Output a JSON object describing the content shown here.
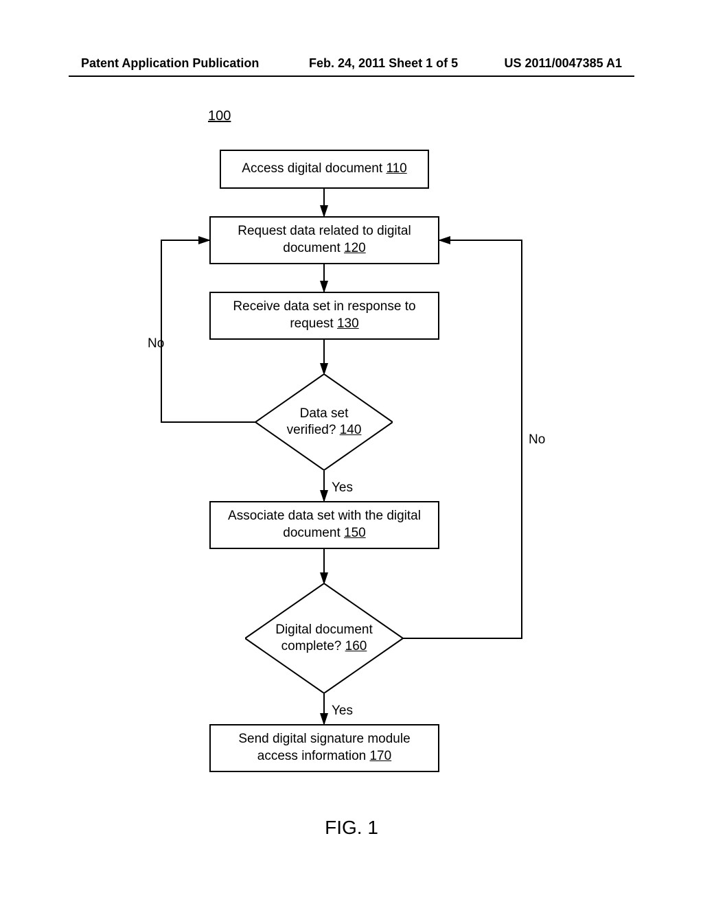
{
  "header": {
    "left": "Patent Application Publication",
    "mid": "Feb. 24, 2011  Sheet 1 of 5",
    "right": "US 2011/0047385 A1"
  },
  "diagram": {
    "ref": "100",
    "figure_caption": "FIG. 1",
    "nodes": {
      "n110": {
        "text": "Access digital document",
        "ref": "110"
      },
      "n120": {
        "text_line1": "Request data related to digital",
        "text_line2": "document",
        "ref": "120"
      },
      "n130": {
        "text_line1": "Receive data set in response to",
        "text_line2": "request",
        "ref": "130"
      },
      "n140": {
        "text_line1": "Data set",
        "text_line2": "verified?",
        "ref": "140"
      },
      "n150": {
        "text_line1": "Associate data set with the digital",
        "text_line2": "document",
        "ref": "150"
      },
      "n160": {
        "text_line1": "Digital document",
        "text_line2": "complete?",
        "ref": "160"
      },
      "n170": {
        "text_line1": "Send digital signature module",
        "text_line2": "access information",
        "ref": "170"
      }
    },
    "labels": {
      "no_left": "No",
      "no_right": "No",
      "yes1": "Yes",
      "yes2": "Yes"
    }
  }
}
